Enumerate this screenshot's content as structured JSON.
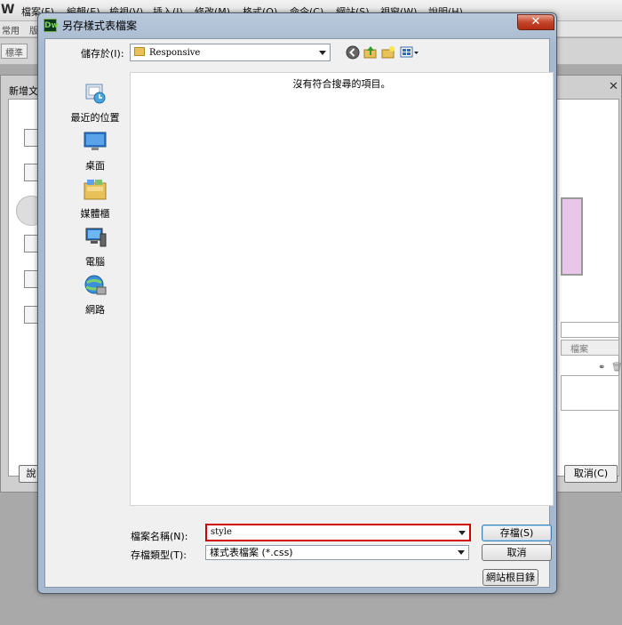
{
  "app": {
    "logo": "W",
    "menu": [
      "檔案(F)",
      "編輯(E)",
      "檢視(V)",
      "插入(I)",
      "修改(M)",
      "格式(O)",
      "命令(C)",
      "網站(S)",
      "視窗(W)",
      "說明(H)"
    ],
    "toolbar1": [
      "常用",
      "版"
    ],
    "toolbar2_button": "標準"
  },
  "newdoc": {
    "title": "新增文",
    "close": "✕",
    "help_button": "說",
    "cancel_button": "取消(C)",
    "field_label": "檔案"
  },
  "dialog": {
    "icon_text": "Dw",
    "title": "另存樣式表檔案",
    "close": "✕",
    "save_in_label": "儲存於(I):",
    "save_in_value": "Responsive",
    "empty_message": "沒有符合搜尋的項目。",
    "places": [
      {
        "label": "最近的位置",
        "icon": "recent-places-icon"
      },
      {
        "label": "桌面",
        "icon": "desktop-icon"
      },
      {
        "label": "媒體櫃",
        "icon": "libraries-icon"
      },
      {
        "label": "電腦",
        "icon": "computer-icon"
      },
      {
        "label": "網路",
        "icon": "network-icon"
      }
    ],
    "filename_label": "檔案名稱(N):",
    "filename_value": "style",
    "filetype_label": "存檔類型(T):",
    "filetype_value": "樣式表檔案 (*.css)",
    "save_button": "存檔(S)",
    "cancel_button": "取消",
    "site_root_button": "網站根目錄",
    "colors": {
      "highlight_border": "#d00000",
      "title_bar": "#a7b9cf"
    }
  }
}
